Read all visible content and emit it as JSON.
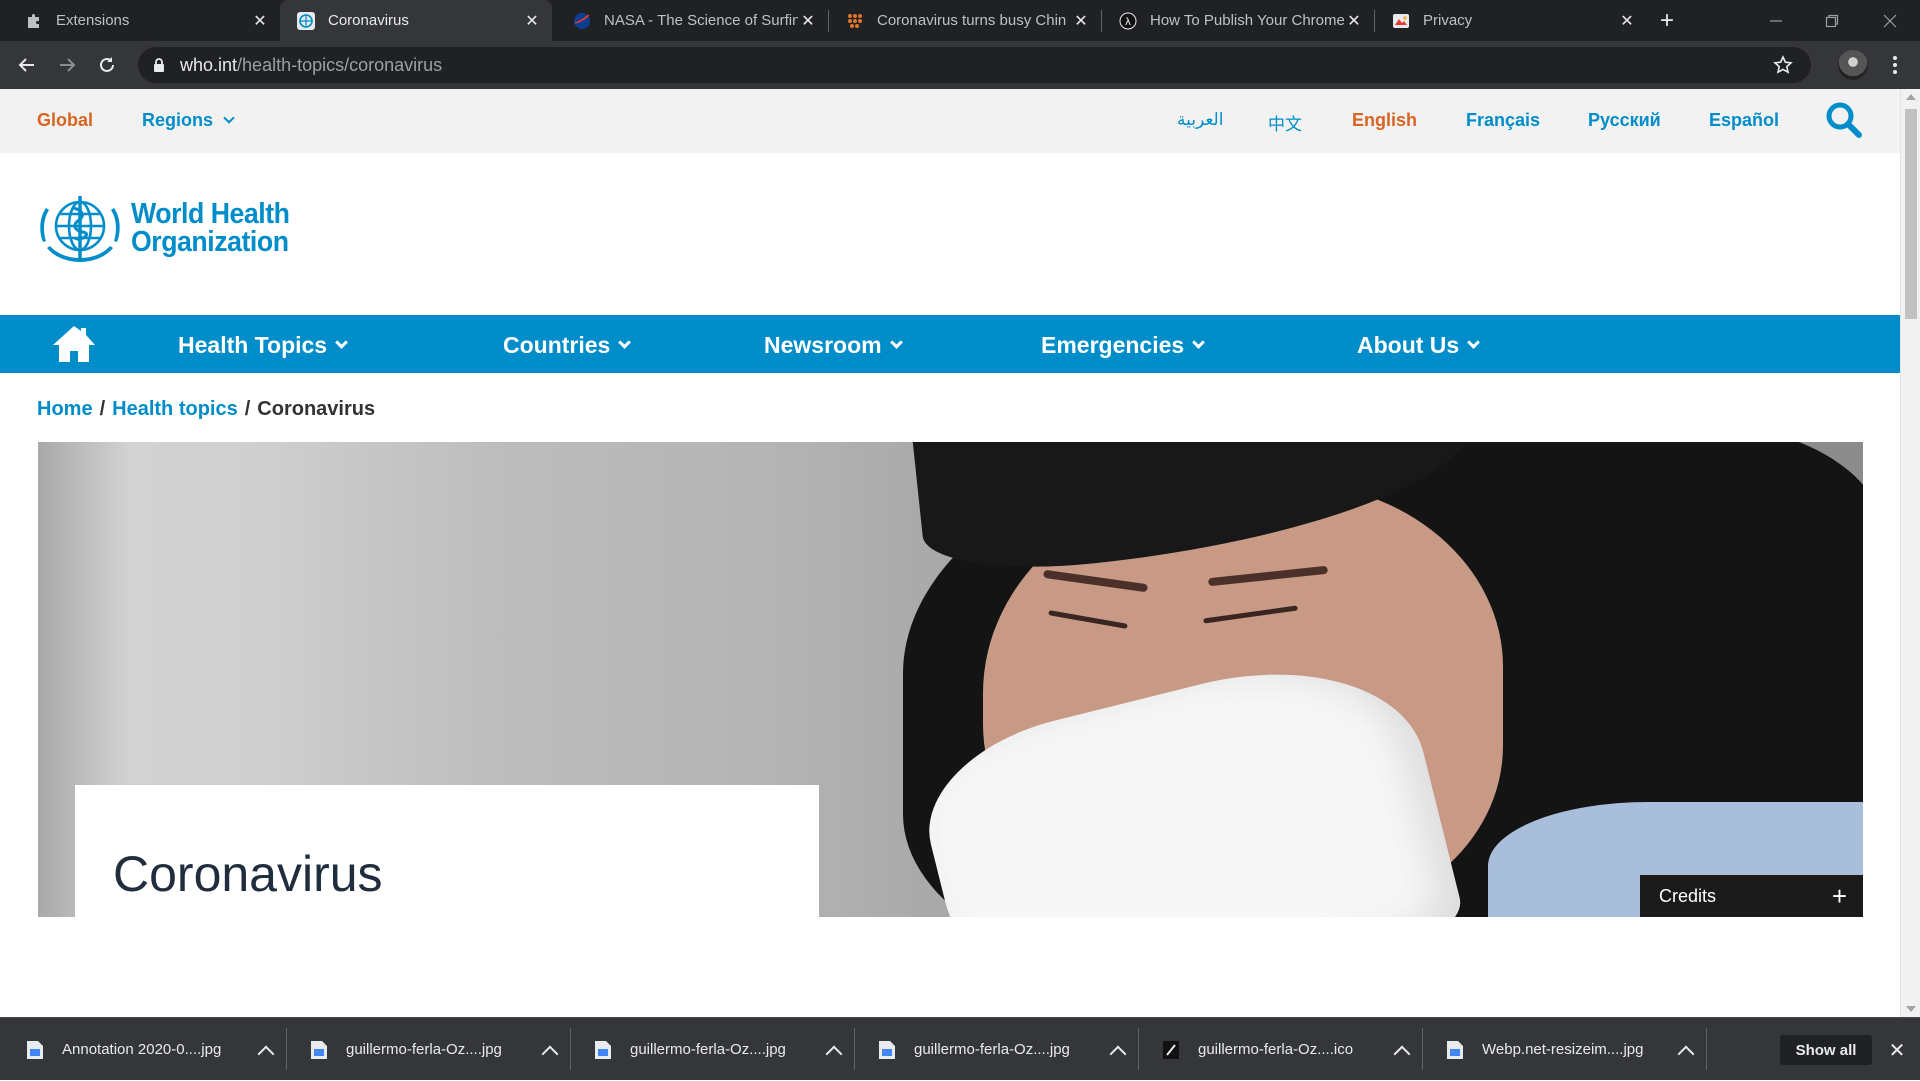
{
  "browser": {
    "tabs": [
      {
        "title": "Extensions",
        "icon": "puzzle-icon",
        "active": false
      },
      {
        "title": "Coronavirus",
        "icon": "who-globe-icon",
        "active": true
      },
      {
        "title": "NASA - The Science of Surfin",
        "icon": "nasa-icon",
        "active": false
      },
      {
        "title": "Coronavirus turns busy Chin",
        "icon": "dots-icon",
        "active": false
      },
      {
        "title": "How To Publish Your Chrome",
        "icon": "lambda-icon",
        "active": false
      },
      {
        "title": "Privacy",
        "icon": "privacy-icon",
        "active": false
      }
    ],
    "url_domain": "who.int",
    "url_path": "/health-topics/coronavirus"
  },
  "page": {
    "topbar": {
      "global": "Global",
      "regions": "Regions",
      "languages": [
        "العربية",
        "中文",
        "English",
        "Français",
        "Русский",
        "Español"
      ],
      "active_language": "English"
    },
    "logo": {
      "line1": "World Health",
      "line2": "Organization"
    },
    "nav": [
      "Health Topics",
      "Countries",
      "Newsroom",
      "Emergencies",
      "About Us"
    ],
    "breadcrumb": {
      "home": "Home",
      "section": "Health topics",
      "current": "Coronavirus",
      "separator": "/"
    },
    "hero": {
      "title": "Coronavirus",
      "credits": "Credits",
      "credits_toggle": "+"
    }
  },
  "downloads": {
    "items": [
      {
        "name": "Annotation 2020-0....jpg",
        "icon": "image-file-icon"
      },
      {
        "name": "guillermo-ferla-Oz....jpg",
        "icon": "image-file-icon"
      },
      {
        "name": "guillermo-ferla-Oz....jpg",
        "icon": "image-file-icon"
      },
      {
        "name": "guillermo-ferla-Oz....jpg",
        "icon": "image-file-icon"
      },
      {
        "name": "guillermo-ferla-Oz....ico",
        "icon": "ico-file-icon"
      },
      {
        "name": "Webp.net-resizeim....jpg",
        "icon": "image-file-icon"
      }
    ],
    "show_all": "Show all"
  },
  "colors": {
    "who_blue": "#008dc9",
    "who_orange": "#d86422",
    "chrome_dark": "#202124",
    "chrome_toolbar": "#35363a"
  }
}
